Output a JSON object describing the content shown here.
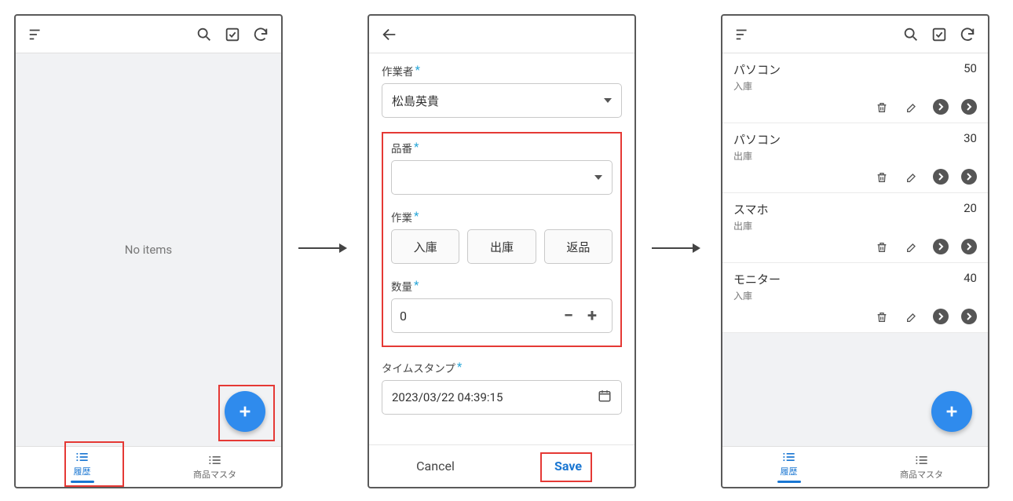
{
  "screens": {
    "empty": {
      "no_items": "No items"
    },
    "form": {
      "fields": {
        "worker_label": "作業者",
        "worker_value": "松島英貴",
        "partno_label": "品番",
        "operation_label": "作業",
        "op_in": "入庫",
        "op_out": "出庫",
        "op_return": "返品",
        "qty_label": "数量",
        "qty_value": "0",
        "timestamp_label": "タイムスタンプ",
        "timestamp_value": "2023/03/22 04:39:15"
      },
      "actions": {
        "cancel": "Cancel",
        "save": "Save"
      }
    },
    "list": {
      "items": [
        {
          "name": "パソコン",
          "op": "入庫",
          "qty": "50"
        },
        {
          "name": "パソコン",
          "op": "出庫",
          "qty": "30"
        },
        {
          "name": "スマホ",
          "op": "出庫",
          "qty": "20"
        },
        {
          "name": "モニター",
          "op": "入庫",
          "qty": "40"
        }
      ]
    }
  },
  "nav": {
    "history": "履歴",
    "master": "商品マスタ"
  }
}
